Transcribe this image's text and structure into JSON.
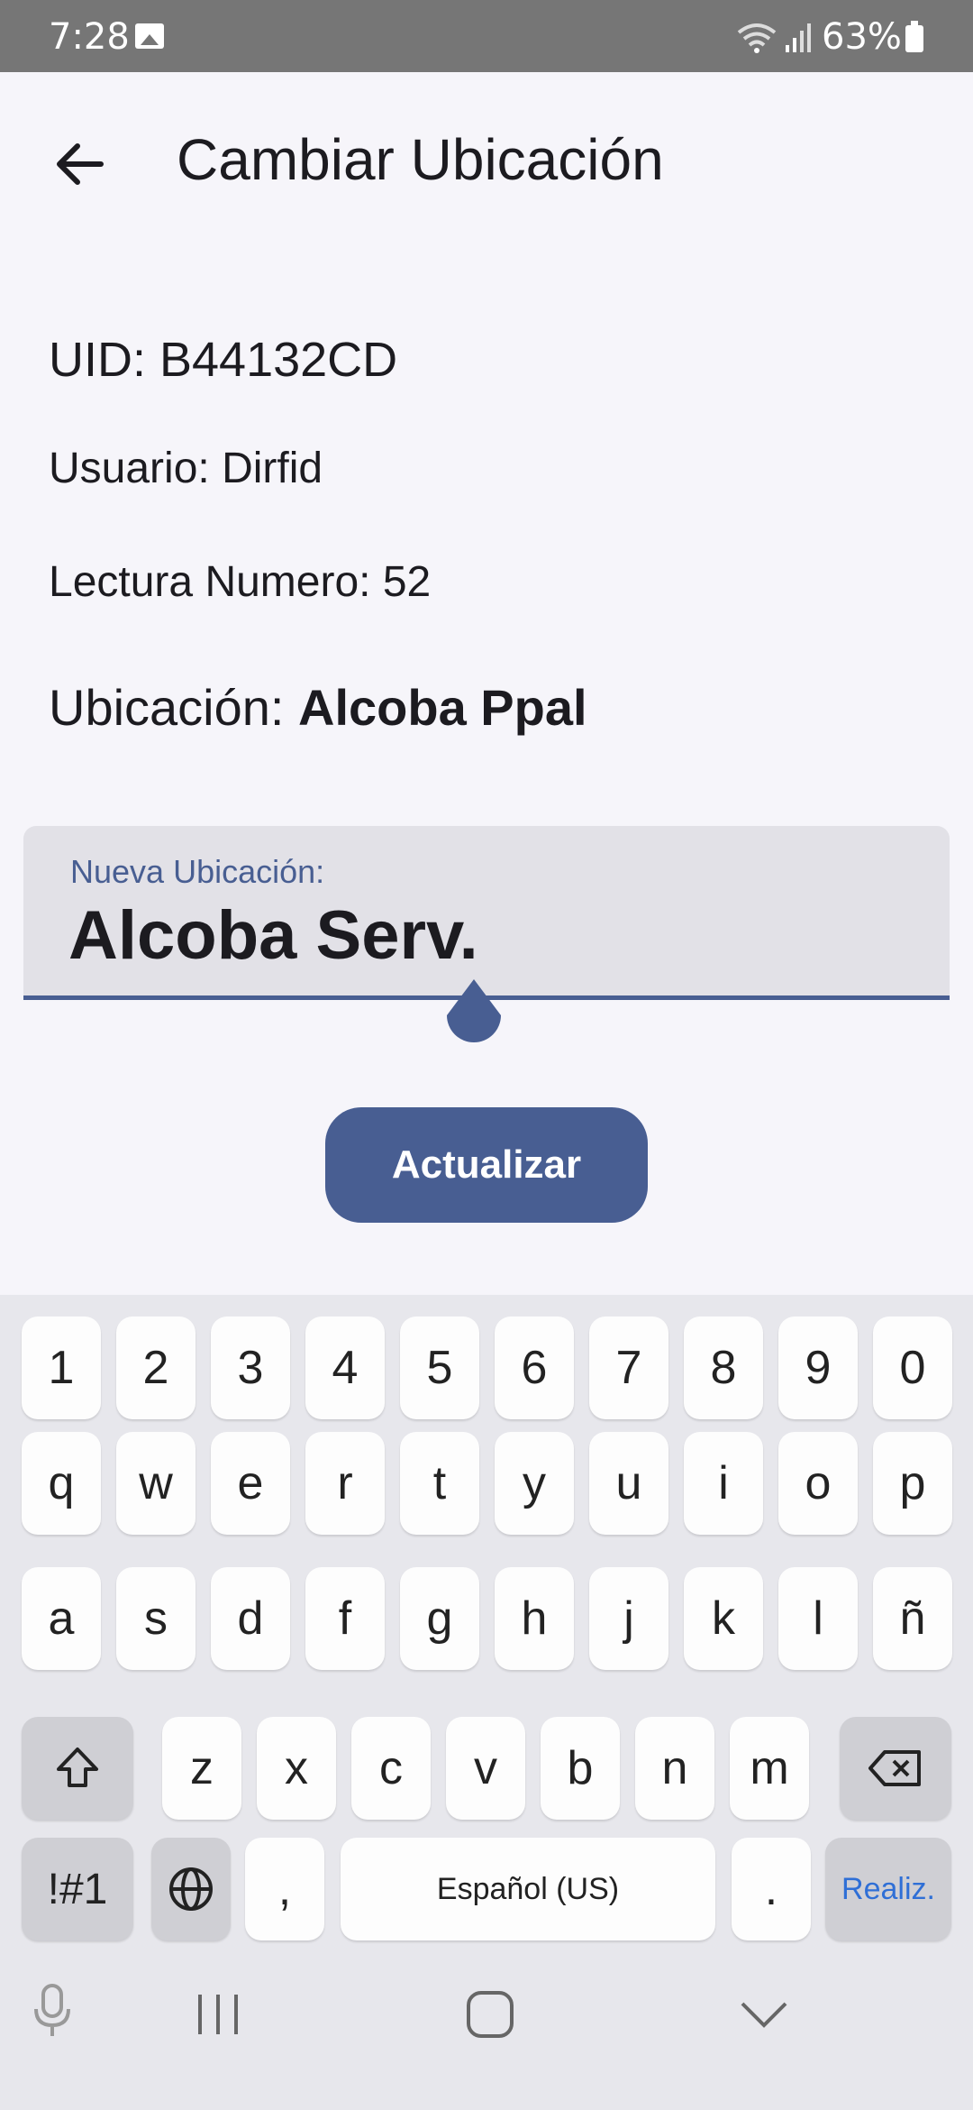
{
  "status_bar": {
    "time": "7:28",
    "battery": "63%"
  },
  "app_bar": {
    "title": "Cambiar Ubicación"
  },
  "info": {
    "uid": "UID: B44132CD",
    "usuario": "Usuario: Dirfid",
    "lectura": "Lectura Numero: 52",
    "ubicacion_label": "Ubicación: ",
    "ubicacion_value": "Alcoba Ppal"
  },
  "field": {
    "label": "Nueva Ubicación:",
    "value": "Alcoba Serv."
  },
  "button": {
    "label": "Actualizar"
  },
  "keyboard": {
    "row_numbers": [
      "1",
      "2",
      "3",
      "4",
      "5",
      "6",
      "7",
      "8",
      "9",
      "0"
    ],
    "row1": [
      "q",
      "w",
      "e",
      "r",
      "t",
      "y",
      "u",
      "i",
      "o",
      "p"
    ],
    "row2": [
      "a",
      "s",
      "d",
      "f",
      "g",
      "h",
      "j",
      "k",
      "l",
      "ñ"
    ],
    "row3": [
      "z",
      "x",
      "c",
      "v",
      "b",
      "n",
      "m"
    ],
    "symbols_key": "!#1",
    "comma": ",",
    "space": "Español (US)",
    "period": ".",
    "done": "Realiz."
  }
}
